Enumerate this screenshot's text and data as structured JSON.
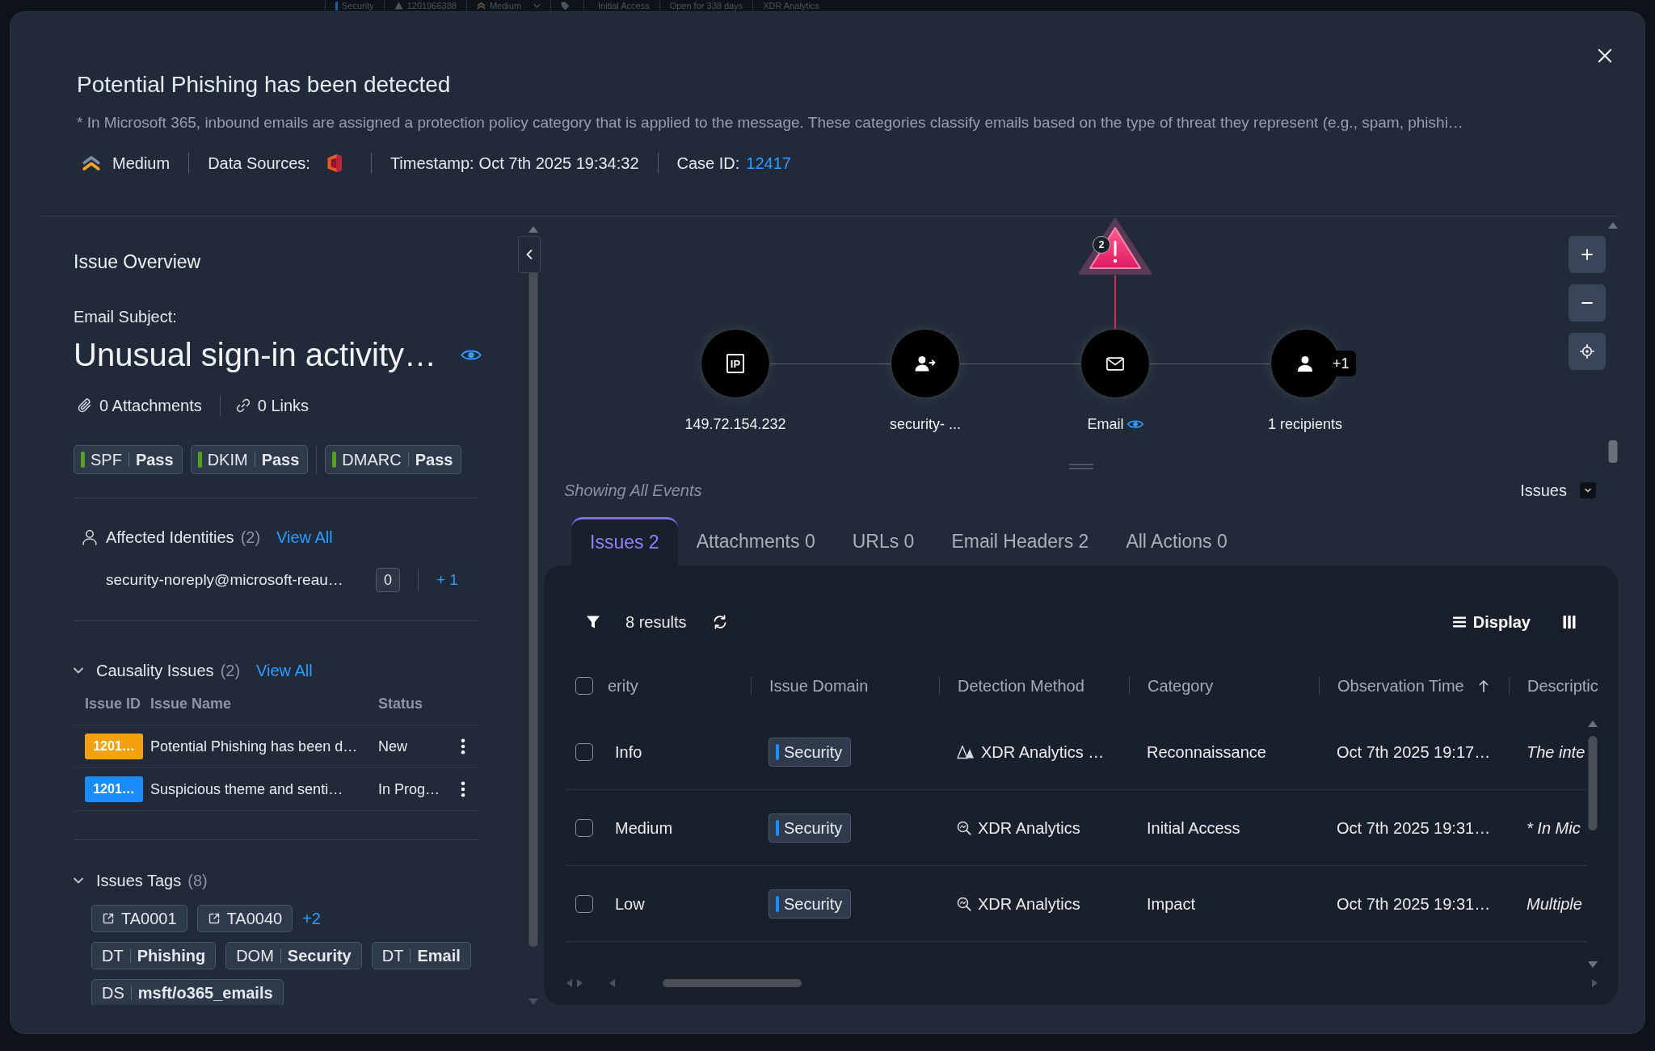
{
  "background_bar": {
    "items": [
      {
        "kind": "domain",
        "text": "Security"
      },
      {
        "kind": "issue",
        "text": "1201966388"
      },
      {
        "kind": "severity",
        "text": "Medium"
      },
      {
        "kind": "category",
        "text": "Initial Access"
      },
      {
        "kind": "plain",
        "text": "Open for 338 days"
      },
      {
        "kind": "plain",
        "text": "XDR Analytics"
      }
    ]
  },
  "modal": {
    "title": "Potential Phishing has been detected",
    "description": "* In Microsoft 365, inbound emails are assigned a protection policy category that is applied to the message. These categories classify emails based on the type of threat they represent (e.g., spam, phishi…",
    "severity": {
      "kind": "medium",
      "label": "Medium"
    },
    "data_sources_label": "Data Sources:",
    "timestamp_label": "Timestamp:",
    "timestamp": "Oct 7th 2025 19:34:32",
    "case_label": "Case ID:",
    "case_id": "12417"
  },
  "overview": {
    "heading": "Issue Overview",
    "subject_label": "Email Subject:",
    "subject": "Unusual sign-in activity…",
    "attachments": "0 Attachments",
    "links": "0 Links",
    "auth_checks": [
      {
        "name": "SPF",
        "result": "Pass",
        "passed": true
      },
      {
        "name": "DKIM",
        "result": "Pass",
        "passed": true
      },
      {
        "name": "DMARC",
        "result": "Pass",
        "passed": true
      }
    ]
  },
  "affected_identities": {
    "title": "Affected Identities",
    "count": "(2)",
    "view_all": "View All",
    "items": [
      {
        "email": "security-noreply@microsoft-reau…",
        "count": "0",
        "more": "+ 1"
      }
    ]
  },
  "causality_issues": {
    "title": "Causality Issues",
    "count": "(2)",
    "view_all": "View All",
    "expanded": true,
    "columns": [
      "Issue ID",
      "Issue Name",
      "Status"
    ],
    "rows": [
      {
        "id": "1201…",
        "color": "#f5a10e",
        "name": "Potential Phishing has been d…",
        "status": "New"
      },
      {
        "id": "1201…",
        "color": "#1a8cff",
        "name": "Suspicious theme and senti…",
        "status": "In Prog…"
      }
    ]
  },
  "issue_tags": {
    "title": "Issues Tags",
    "count": "(8)",
    "expanded": true,
    "tags": [
      {
        "kind": "link",
        "label": "TA0001"
      },
      {
        "kind": "link",
        "label": "TA0040"
      },
      {
        "kind": "more",
        "label": "+2"
      },
      {
        "kind": "pair",
        "key": "DT",
        "value": "Phishing"
      },
      {
        "kind": "pair",
        "key": "DOM",
        "value": "Security"
      },
      {
        "kind": "pair",
        "key": "DT",
        "value": "Email"
      },
      {
        "kind": "pair",
        "key": "DS",
        "value": "msft/o365_emails"
      }
    ]
  },
  "graph": {
    "nodes": [
      {
        "kind": "ip",
        "icon_text": "IP",
        "label": "149.72.154.232"
      },
      {
        "kind": "sender",
        "label": "security- ..."
      },
      {
        "kind": "email",
        "label": "Email",
        "preview": true,
        "alert": {
          "count": "2"
        }
      },
      {
        "kind": "recipient",
        "label": "1 recipients",
        "extra": "+1"
      }
    ]
  },
  "events": {
    "caption": "Showing All Events",
    "view_select": "Issues",
    "tabs": [
      {
        "label": "Issues 2",
        "selected": true
      },
      {
        "label": "Attachments 0",
        "selected": false
      },
      {
        "label": "URLs 0",
        "selected": false
      },
      {
        "label": "Email Headers 2",
        "selected": false
      },
      {
        "label": "All Actions 0",
        "selected": false
      }
    ]
  },
  "table": {
    "results": "8 results",
    "display": "Display",
    "all_checked": false,
    "columns": [
      {
        "label": "erity",
        "sorted": false
      },
      {
        "label": "Issue Domain",
        "sorted": false
      },
      {
        "label": "Detection Method",
        "sorted": false
      },
      {
        "label": "Category",
        "sorted": false
      },
      {
        "label": "Observation Time",
        "sorted": true
      },
      {
        "label": "Descriptic",
        "sorted": false
      }
    ],
    "rows": [
      {
        "checked": false,
        "severity": "Info",
        "domain": "Security",
        "method": {
          "kind": "bioc",
          "text": "XDR Analytics …"
        },
        "category": "Reconnaissance",
        "observed": "Oct 7th 2025 19:17…",
        "description": "The inte"
      },
      {
        "checked": false,
        "severity": "Medium",
        "domain": "Security",
        "method": {
          "kind": "analytics",
          "text": "XDR Analytics"
        },
        "category": "Initial Access",
        "observed": "Oct 7th 2025 19:31…",
        "description": "* In Mic"
      },
      {
        "checked": false,
        "severity": "Low",
        "domain": "Security",
        "method": {
          "kind": "analytics",
          "text": "XDR Analytics"
        },
        "category": "Impact",
        "observed": "Oct 7th 2025 19:31…",
        "description": "Multiple"
      }
    ]
  }
}
